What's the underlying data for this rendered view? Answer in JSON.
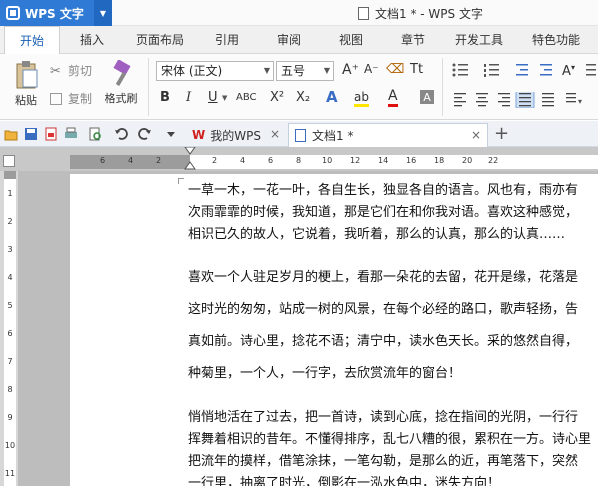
{
  "app": {
    "name": "WPS 文字",
    "dropdown": "▼"
  },
  "window": {
    "title": "文档1 * - WPS 文字"
  },
  "menu": {
    "tabs": [
      "开始",
      "插入",
      "页面布局",
      "引用",
      "审阅",
      "视图",
      "章节",
      "开发工具",
      "特色功能"
    ]
  },
  "ribbon": {
    "paste_label": "粘贴",
    "cut_label": "剪切",
    "copy_label": "复制",
    "format_painter_label": "格式刷",
    "font_name": "宋体 (正文)",
    "font_size": "五号",
    "bold": "B",
    "italic": "I",
    "underline": "U",
    "superscript": "X²",
    "subscript": "X₂",
    "grow_font": "A⁺",
    "shrink_font": "A⁻",
    "font_color": "A",
    "highlight": "ab",
    "text_effect": "A"
  },
  "quickbar": {
    "doc_tabs": [
      {
        "label": "我的WPS",
        "close": "×"
      },
      {
        "label": "文档1 *",
        "close": "×"
      }
    ],
    "new_tab": "+"
  },
  "ruler": {
    "h_ticks": [
      "6",
      "4",
      "2",
      "2",
      "4",
      "6",
      "8",
      "10",
      "12",
      "14",
      "16",
      "18",
      "20",
      "22"
    ],
    "v_ticks": [
      "1",
      "2",
      "3",
      "4",
      "5",
      "6",
      "7",
      "8",
      "9",
      "10",
      "11"
    ]
  },
  "document": {
    "lines": [
      "一草一木，一花一叶，各自生长，独显各自的语言。风也有，雨亦有",
      "次雨霏霏的时候，我知道，那是它们在和你我对语。喜欢这种感觉，",
      "相识已久的故人，它说着，我听着，那么的认真，那么的认真……",
      "喜欢一个人驻足岁月的梗上，看那一朵花的去留，花开是缘，花落是",
      "这时光的匆匆，站成一树的风景，在每个必经的路口，歌声轻扬，告",
      "真如前。诗心里，捻花不语；清宁中，读水色天长。采的悠然自得，",
      "种菊里，一个人，一行字，去欣赏流年的窗台！",
      "悄悄地活在了过去，把一首诗，读到心底，捻在指间的光阴，一行行",
      "挥舞着相识的昔年。不懂得排序，乱七八糟的很，累积在一方。诗心里",
      "把流年的摸样，借笔涂抹，一笔勾勒，是那么的近，再笔落下，突然",
      "一行里，抽离了时光，倒影在一泓水色中，迷失方向！"
    ]
  },
  "colors": {
    "accent": "#2e7ad4",
    "tab_active": "#1a5fb4"
  }
}
